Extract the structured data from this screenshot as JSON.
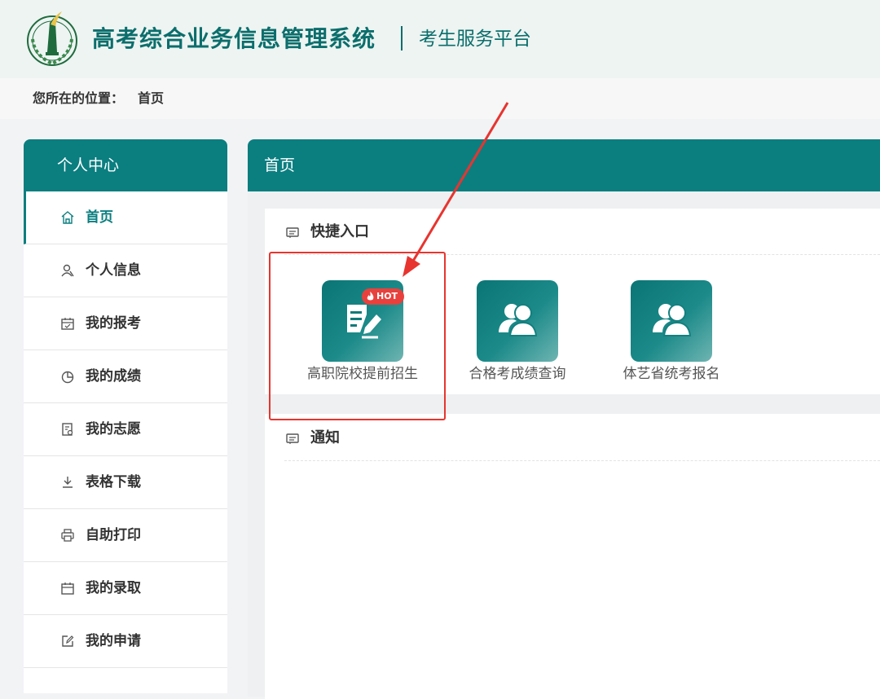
{
  "header": {
    "system_title": "高考综合业务信息管理系统",
    "platform_title": "考生服务平台"
  },
  "breadcrumb": {
    "label": "您所在的位置：",
    "current": "首页"
  },
  "sidebar": {
    "heading": "个人中心",
    "items": [
      {
        "label": "首页",
        "icon": "home-icon",
        "active": true
      },
      {
        "label": "个人信息",
        "icon": "user-icon"
      },
      {
        "label": "我的报考",
        "icon": "calendar-check-icon"
      },
      {
        "label": "我的成绩",
        "icon": "pie-chart-icon"
      },
      {
        "label": "我的志愿",
        "icon": "document-icon"
      },
      {
        "label": "表格下载",
        "icon": "download-icon"
      },
      {
        "label": "自助打印",
        "icon": "printer-icon"
      },
      {
        "label": "我的录取",
        "icon": "calendar-icon"
      },
      {
        "label": "我的申请",
        "icon": "edit-icon"
      }
    ]
  },
  "main": {
    "heading": "首页",
    "quick_entry": {
      "title": "快捷入口",
      "items": [
        {
          "label": "高职院校提前招生",
          "icon": "edit-document-icon",
          "badge": "HOT"
        },
        {
          "label": "合格考成绩查询",
          "icon": "users-icon"
        },
        {
          "label": "体艺省统考报名",
          "icon": "users-icon"
        }
      ]
    },
    "notice": {
      "title": "通知"
    }
  },
  "colors": {
    "brand": "#0b7e80",
    "title_text": "#0b6e6c",
    "hot_badge": "#e8413d",
    "annotation": "#e8342f"
  }
}
